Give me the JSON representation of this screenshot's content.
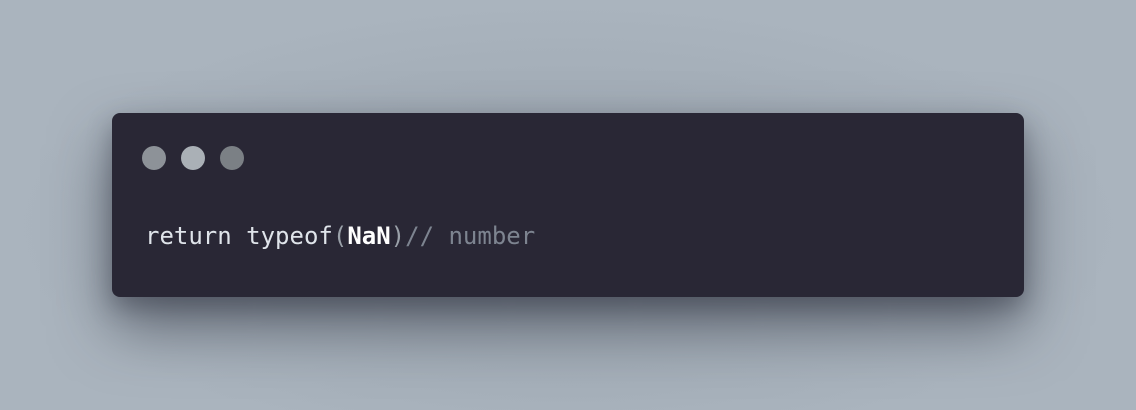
{
  "window": {
    "controls": [
      {
        "name": "close-control",
        "color": "#8d9298"
      },
      {
        "name": "minimize-control",
        "color": "#aab0b6"
      },
      {
        "name": "maximize-control",
        "color": "#7b8085"
      }
    ]
  },
  "code": {
    "keyword": "return",
    "space": " ",
    "function": "typeof",
    "open_paren": "(",
    "argument": "NaN",
    "close_paren": ")",
    "comment": "// number"
  },
  "colors": {
    "background": "#aab4be",
    "window": "#292735",
    "text": "#dde3ea",
    "comment": "#7d8490"
  }
}
